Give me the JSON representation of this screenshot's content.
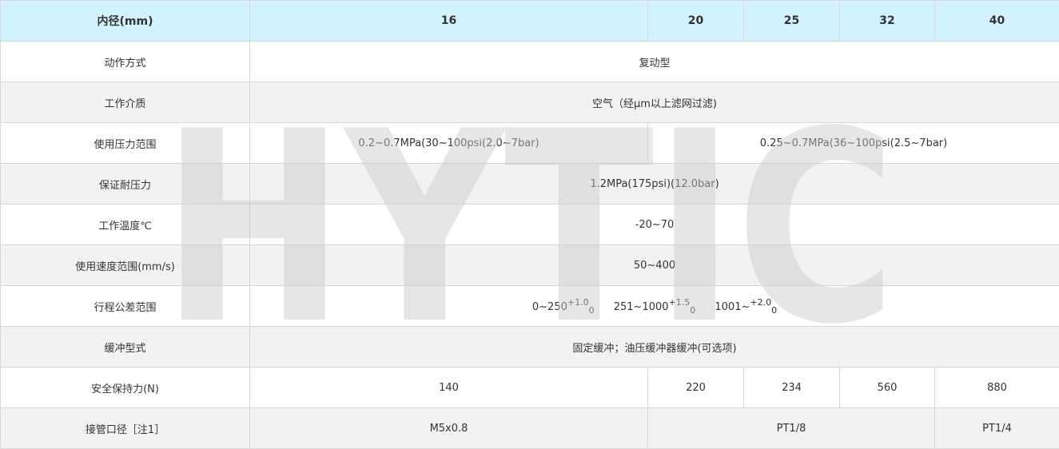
{
  "header": {
    "label": "内径(mm)",
    "bores": [
      "16",
      "20",
      "25",
      "32",
      "40"
    ]
  },
  "rows": {
    "action": {
      "label": "动作方式",
      "value": "复动型"
    },
    "medium": {
      "label": "工作介质",
      "value": "空气（经μm以上滤网过滤)"
    },
    "pressure": {
      "label": "使用压力范围",
      "small": "0.2~0.7MPa(30~100psi(2.0~7bar)",
      "large": "0.25~0.7MPa(36~100psi(2.5~7bar)"
    },
    "proof": {
      "label": "保证耐压力",
      "value": "1.2MPa(175psi)(12.0bar)"
    },
    "temp": {
      "label": "工作温度℃",
      "value": "-20~70"
    },
    "speed": {
      "label": "使用速度范围(mm/s)",
      "value": "50~400"
    },
    "stroke": {
      "label": "行程公差范围",
      "items": [
        {
          "base": "0~250",
          "sup": "+1.0",
          "sub": "0"
        },
        {
          "base": "251~1000",
          "sup": "+1.5",
          "sub": "0"
        },
        {
          "base": "1001~",
          "sup": "+2.0",
          "sub": "0"
        }
      ]
    },
    "cushion": {
      "label": "缓冲型式",
      "value": "固定缓冲；油压缓冲器缓冲(可选项)"
    },
    "force": {
      "label": "安全保持力(N)",
      "values": [
        "140",
        "220",
        "234",
        "560",
        "880"
      ]
    },
    "port": {
      "label": "接管口径［注1］",
      "small": "M5x0.8",
      "mid": "PT1/8",
      "large": "PT1/4"
    }
  },
  "watermark": "HYTIC",
  "colors": {
    "header_bg": "#d2f3fd",
    "row_alt_bg": "#f2f2f2",
    "border": "#d7d7d7"
  }
}
